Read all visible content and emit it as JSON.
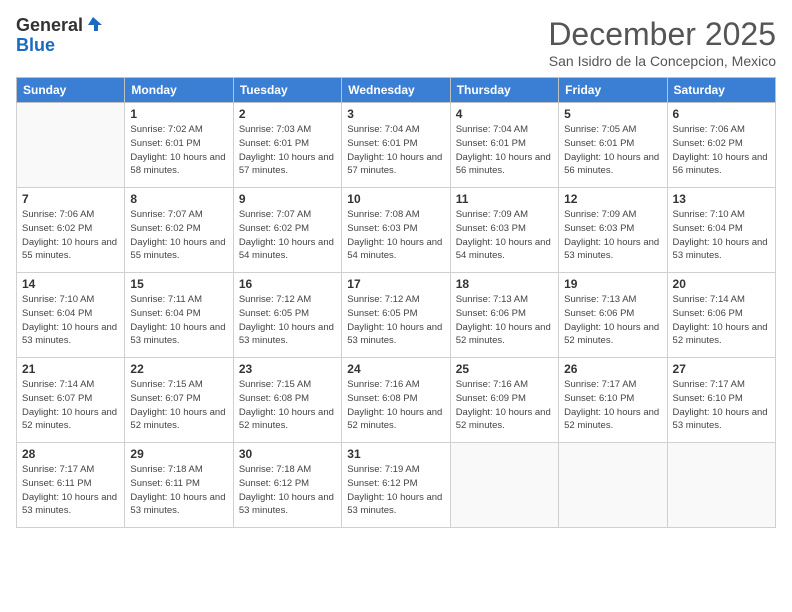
{
  "logo": {
    "general": "General",
    "blue": "Blue"
  },
  "title": "December 2025",
  "location": "San Isidro de la Concepcion, Mexico",
  "days_header": [
    "Sunday",
    "Monday",
    "Tuesday",
    "Wednesday",
    "Thursday",
    "Friday",
    "Saturday"
  ],
  "weeks": [
    [
      {
        "day": "",
        "sunrise": "",
        "sunset": "",
        "daylight": ""
      },
      {
        "day": "1",
        "sunrise": "Sunrise: 7:02 AM",
        "sunset": "Sunset: 6:01 PM",
        "daylight": "Daylight: 10 hours and 58 minutes."
      },
      {
        "day": "2",
        "sunrise": "Sunrise: 7:03 AM",
        "sunset": "Sunset: 6:01 PM",
        "daylight": "Daylight: 10 hours and 57 minutes."
      },
      {
        "day": "3",
        "sunrise": "Sunrise: 7:04 AM",
        "sunset": "Sunset: 6:01 PM",
        "daylight": "Daylight: 10 hours and 57 minutes."
      },
      {
        "day": "4",
        "sunrise": "Sunrise: 7:04 AM",
        "sunset": "Sunset: 6:01 PM",
        "daylight": "Daylight: 10 hours and 56 minutes."
      },
      {
        "day": "5",
        "sunrise": "Sunrise: 7:05 AM",
        "sunset": "Sunset: 6:01 PM",
        "daylight": "Daylight: 10 hours and 56 minutes."
      },
      {
        "day": "6",
        "sunrise": "Sunrise: 7:06 AM",
        "sunset": "Sunset: 6:02 PM",
        "daylight": "Daylight: 10 hours and 56 minutes."
      }
    ],
    [
      {
        "day": "7",
        "sunrise": "Sunrise: 7:06 AM",
        "sunset": "Sunset: 6:02 PM",
        "daylight": "Daylight: 10 hours and 55 minutes."
      },
      {
        "day": "8",
        "sunrise": "Sunrise: 7:07 AM",
        "sunset": "Sunset: 6:02 PM",
        "daylight": "Daylight: 10 hours and 55 minutes."
      },
      {
        "day": "9",
        "sunrise": "Sunrise: 7:07 AM",
        "sunset": "Sunset: 6:02 PM",
        "daylight": "Daylight: 10 hours and 54 minutes."
      },
      {
        "day": "10",
        "sunrise": "Sunrise: 7:08 AM",
        "sunset": "Sunset: 6:03 PM",
        "daylight": "Daylight: 10 hours and 54 minutes."
      },
      {
        "day": "11",
        "sunrise": "Sunrise: 7:09 AM",
        "sunset": "Sunset: 6:03 PM",
        "daylight": "Daylight: 10 hours and 54 minutes."
      },
      {
        "day": "12",
        "sunrise": "Sunrise: 7:09 AM",
        "sunset": "Sunset: 6:03 PM",
        "daylight": "Daylight: 10 hours and 53 minutes."
      },
      {
        "day": "13",
        "sunrise": "Sunrise: 7:10 AM",
        "sunset": "Sunset: 6:04 PM",
        "daylight": "Daylight: 10 hours and 53 minutes."
      }
    ],
    [
      {
        "day": "14",
        "sunrise": "Sunrise: 7:10 AM",
        "sunset": "Sunset: 6:04 PM",
        "daylight": "Daylight: 10 hours and 53 minutes."
      },
      {
        "day": "15",
        "sunrise": "Sunrise: 7:11 AM",
        "sunset": "Sunset: 6:04 PM",
        "daylight": "Daylight: 10 hours and 53 minutes."
      },
      {
        "day": "16",
        "sunrise": "Sunrise: 7:12 AM",
        "sunset": "Sunset: 6:05 PM",
        "daylight": "Daylight: 10 hours and 53 minutes."
      },
      {
        "day": "17",
        "sunrise": "Sunrise: 7:12 AM",
        "sunset": "Sunset: 6:05 PM",
        "daylight": "Daylight: 10 hours and 53 minutes."
      },
      {
        "day": "18",
        "sunrise": "Sunrise: 7:13 AM",
        "sunset": "Sunset: 6:06 PM",
        "daylight": "Daylight: 10 hours and 52 minutes."
      },
      {
        "day": "19",
        "sunrise": "Sunrise: 7:13 AM",
        "sunset": "Sunset: 6:06 PM",
        "daylight": "Daylight: 10 hours and 52 minutes."
      },
      {
        "day": "20",
        "sunrise": "Sunrise: 7:14 AM",
        "sunset": "Sunset: 6:06 PM",
        "daylight": "Daylight: 10 hours and 52 minutes."
      }
    ],
    [
      {
        "day": "21",
        "sunrise": "Sunrise: 7:14 AM",
        "sunset": "Sunset: 6:07 PM",
        "daylight": "Daylight: 10 hours and 52 minutes."
      },
      {
        "day": "22",
        "sunrise": "Sunrise: 7:15 AM",
        "sunset": "Sunset: 6:07 PM",
        "daylight": "Daylight: 10 hours and 52 minutes."
      },
      {
        "day": "23",
        "sunrise": "Sunrise: 7:15 AM",
        "sunset": "Sunset: 6:08 PM",
        "daylight": "Daylight: 10 hours and 52 minutes."
      },
      {
        "day": "24",
        "sunrise": "Sunrise: 7:16 AM",
        "sunset": "Sunset: 6:08 PM",
        "daylight": "Daylight: 10 hours and 52 minutes."
      },
      {
        "day": "25",
        "sunrise": "Sunrise: 7:16 AM",
        "sunset": "Sunset: 6:09 PM",
        "daylight": "Daylight: 10 hours and 52 minutes."
      },
      {
        "day": "26",
        "sunrise": "Sunrise: 7:17 AM",
        "sunset": "Sunset: 6:10 PM",
        "daylight": "Daylight: 10 hours and 52 minutes."
      },
      {
        "day": "27",
        "sunrise": "Sunrise: 7:17 AM",
        "sunset": "Sunset: 6:10 PM",
        "daylight": "Daylight: 10 hours and 53 minutes."
      }
    ],
    [
      {
        "day": "28",
        "sunrise": "Sunrise: 7:17 AM",
        "sunset": "Sunset: 6:11 PM",
        "daylight": "Daylight: 10 hours and 53 minutes."
      },
      {
        "day": "29",
        "sunrise": "Sunrise: 7:18 AM",
        "sunset": "Sunset: 6:11 PM",
        "daylight": "Daylight: 10 hours and 53 minutes."
      },
      {
        "day": "30",
        "sunrise": "Sunrise: 7:18 AM",
        "sunset": "Sunset: 6:12 PM",
        "daylight": "Daylight: 10 hours and 53 minutes."
      },
      {
        "day": "31",
        "sunrise": "Sunrise: 7:19 AM",
        "sunset": "Sunset: 6:12 PM",
        "daylight": "Daylight: 10 hours and 53 minutes."
      },
      {
        "day": "",
        "sunrise": "",
        "sunset": "",
        "daylight": ""
      },
      {
        "day": "",
        "sunrise": "",
        "sunset": "",
        "daylight": ""
      },
      {
        "day": "",
        "sunrise": "",
        "sunset": "",
        "daylight": ""
      }
    ]
  ]
}
